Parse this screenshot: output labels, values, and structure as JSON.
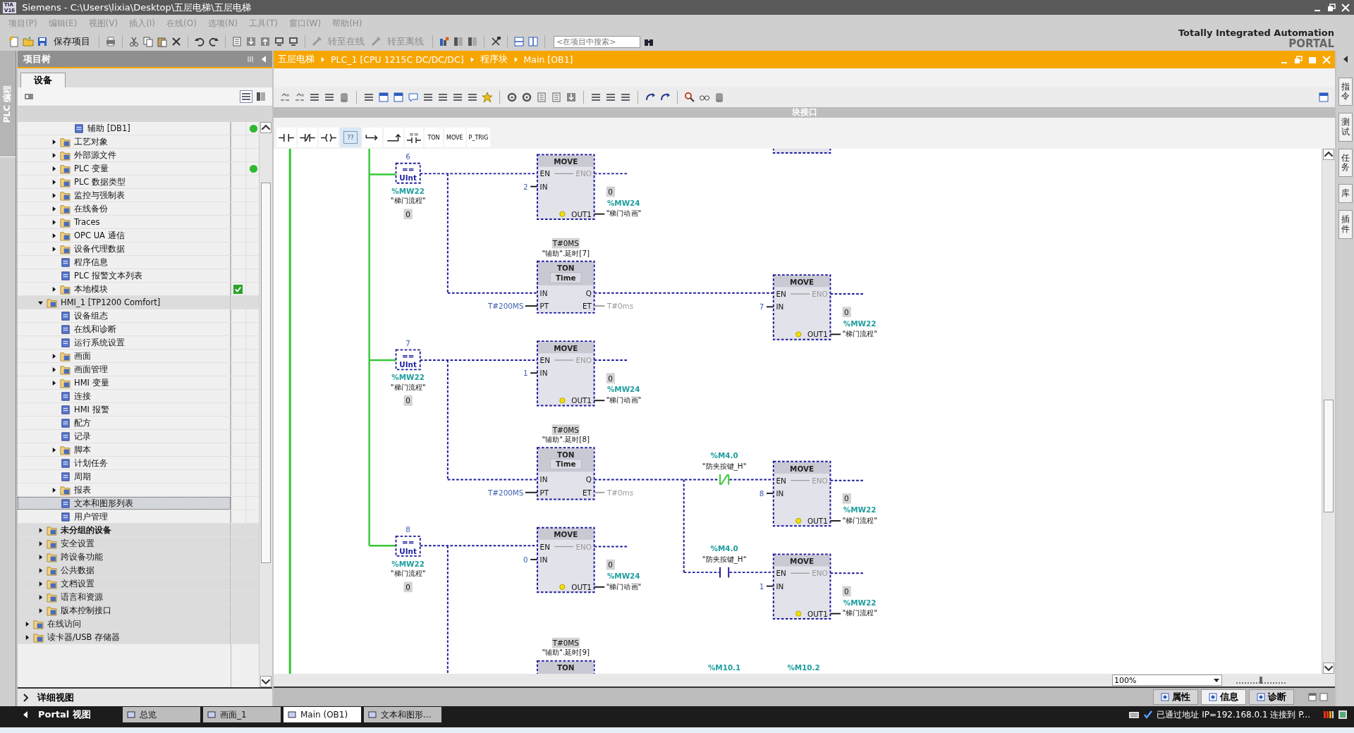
{
  "window": {
    "logo": [
      "TIA",
      "V16"
    ],
    "title": "Siemens  -  C:\\Users\\lixia\\Desktop\\五层电梯\\五层电梯"
  },
  "menu": [
    "项目(P)",
    "编辑(E)",
    "视图(V)",
    "插入(I)",
    "在线(O)",
    "选项(N)",
    "工具(T)",
    "窗口(W)",
    "帮助(H)"
  ],
  "toolbar": {
    "save": "保存项目",
    "go_online": "转至在线",
    "go_offline": "转至离线",
    "search": {
      "placeholder": "<在项目中搜索>"
    }
  },
  "branding": {
    "line1": "Totally Integrated Automation",
    "line2": "PORTAL"
  },
  "side_tab": "PLC 编程",
  "project_tree": {
    "title": "项目树",
    "tabs": [
      {
        "label": "设备",
        "selected": true
      }
    ],
    "items": [
      {
        "children": [
          {
            "children": [
              {
                "children": [
                  {
                    "label": "辅助 [DB1]",
                    "online": true,
                    "selected": false
                  }
                ]
              },
              {
                "label": "工艺对象",
                "expanded": false,
                "selected": false
              },
              {
                "label": "外部源文件",
                "expanded": false,
                "selected": false
              },
              {
                "label": "PLC 变量",
                "expanded": false,
                "online": true,
                "selected": false
              },
              {
                "label": "PLC 数据类型",
                "expanded": false,
                "selected": false
              },
              {
                "label": "监控与强制表",
                "expanded": false,
                "selected": false
              },
              {
                "label": "在线备份",
                "expanded": false,
                "selected": false
              },
              {
                "label": "Traces",
                "expanded": false,
                "selected": false
              },
              {
                "label": "OPC UA 通信",
                "expanded": false,
                "selected": false
              },
              {
                "label": "设备代理数据",
                "expanded": false,
                "selected": false
              },
              {
                "label": "程序信息",
                "selected": false
              },
              {
                "label": "PLC 报警文本列表",
                "selected": false
              },
              {
                "label": "本地模块",
                "expanded": false,
                "consistent": true,
                "selected": false
              }
            ]
          },
          {
            "label": "HMI_1 [TP1200 Comfort]",
            "expanded": true,
            "selected": false,
            "children": [
              {
                "label": "设备组态",
                "selected": false
              },
              {
                "label": "在线和诊断",
                "selected": false
              },
              {
                "label": "运行系统设置",
                "selected": false
              },
              {
                "label": "画面",
                "expanded": false,
                "selected": false
              },
              {
                "label": "画面管理",
                "expanded": false,
                "selected": false
              },
              {
                "label": "HMI 变量",
                "expanded": false,
                "selected": false
              },
              {
                "label": "连接",
                "selected": false
              },
              {
                "label": "HMI 报警",
                "selected": false
              },
              {
                "label": "配方",
                "selected": false
              },
              {
                "label": "记录",
                "selected": false
              },
              {
                "label": "脚本",
                "expanded": false,
                "selected": false
              },
              {
                "label": "计划任务",
                "selected": false
              },
              {
                "label": "周期",
                "selected": false
              },
              {
                "label": "报表",
                "expanded": false,
                "selected": false
              },
              {
                "label": "文本和图形列表",
                "selected": true
              },
              {
                "label": "用户管理",
                "selected": false
              }
            ]
          },
          {
            "label": "未分组的设备",
            "expanded": false,
            "emphasized": true,
            "selected": false
          },
          {
            "label": "安全设置",
            "expanded": false,
            "selected": false
          },
          {
            "label": "跨设备功能",
            "expanded": false,
            "selected": false
          },
          {
            "label": "公共数据",
            "expanded": false,
            "selected": false
          },
          {
            "label": "文档设置",
            "expanded": false,
            "selected": false
          },
          {
            "label": "语言和资源",
            "expanded": false,
            "selected": false
          },
          {
            "label": "版本控制接口",
            "expanded": false,
            "selected": false
          }
        ]
      },
      {
        "label": "在线访问",
        "expanded": false,
        "selected": false
      },
      {
        "label": "读卡器/USB 存储器",
        "expanded": false,
        "selected": false
      }
    ],
    "detail_view": "详细视图"
  },
  "editor": {
    "breadcrumb": [
      "五层电梯",
      "PLC_1 [CPU 1215C DC/DC/DC]",
      "程序块",
      "Main [OB1]"
    ],
    "block_interface": "块接口",
    "favorites": [
      {
        "kind": "no-contact"
      },
      {
        "kind": "nc-contact"
      },
      {
        "kind": "coil"
      },
      {
        "kind": "empty-box",
        "label": "??"
      },
      {
        "kind": "branch-open"
      },
      {
        "kind": "branch-close"
      },
      {
        "kind": "compare",
        "label": "=="
      },
      {
        "kind": "text",
        "label": "TON"
      },
      {
        "kind": "text",
        "label": "MOVE"
      },
      {
        "kind": "text",
        "label": "P_TRIG"
      }
    ],
    "ladder": [
      {
        "kind": "compare",
        "value": "6",
        "operator": "==",
        "data_type": "UInt",
        "address": "%MW22",
        "symbol": "\"梯门流程\"",
        "monitor": "0"
      },
      {
        "kind": "move",
        "title": "MOVE",
        "pins": [
          "EN",
          "ENO",
          "IN",
          "OUT1"
        ],
        "input": "2",
        "monitor": "0",
        "address": "%MW24",
        "symbol": "\"梯门动画\""
      },
      {
        "kind": "ton",
        "preset_monitor": "T#0MS",
        "instance": "\"辅助\".延时[7]",
        "title": "TON",
        "time_type": "Time",
        "pins": [
          "IN",
          "Q",
          "PT",
          "ET"
        ],
        "preset": "T#200MS",
        "elapsed": "T#0ms"
      },
      {
        "kind": "move",
        "title": "MOVE",
        "pins": [
          "EN",
          "ENO",
          "IN",
          "OUT1"
        ],
        "input": "7",
        "monitor": "0",
        "address": "%MW22",
        "symbol": "\"梯门流程\""
      },
      {
        "kind": "compare",
        "value": "7",
        "operator": "==",
        "data_type": "UInt",
        "address": "%MW22",
        "symbol": "\"梯门流程\"",
        "monitor": "0"
      },
      {
        "kind": "move",
        "title": "MOVE",
        "pins": [
          "EN",
          "ENO",
          "IN",
          "OUT1"
        ],
        "input": "1",
        "monitor": "0",
        "address": "%MW24",
        "symbol": "\"梯门动画\""
      },
      {
        "kind": "ton",
        "preset_monitor": "T#0MS",
        "instance": "\"辅助\".延时[8]",
        "title": "TON",
        "time_type": "Time",
        "pins": [
          "IN",
          "Q",
          "PT",
          "ET"
        ],
        "preset": "T#200MS",
        "elapsed": "T#0ms"
      },
      {
        "kind": "contact",
        "negated": true,
        "powered": true,
        "address": "%M4.0",
        "symbol": "\"防夹按键_H\""
      },
      {
        "kind": "move",
        "title": "MOVE",
        "pins": [
          "EN",
          "ENO",
          "IN",
          "OUT1"
        ],
        "input": "8",
        "monitor": "0",
        "address": "%MW22",
        "symbol": "\"梯门流程\""
      },
      {
        "kind": "contact",
        "negated": false,
        "powered": false,
        "address": "%M4.0",
        "symbol": "\"防夹按键_H\""
      },
      {
        "kind": "move",
        "title": "MOVE",
        "pins": [
          "EN",
          "ENO",
          "IN",
          "OUT1"
        ],
        "input": "1",
        "monitor": "0",
        "address": "%MW22",
        "symbol": "\"梯门流程\""
      },
      {
        "kind": "compare",
        "value": "8",
        "operator": "==",
        "data_type": "UInt",
        "address": "%MW22",
        "symbol": "\"梯门流程\"",
        "monitor": "0"
      },
      {
        "kind": "move",
        "title": "MOVE",
        "pins": [
          "EN",
          "ENO",
          "IN",
          "OUT1"
        ],
        "input": "0",
        "monitor": "0",
        "address": "%MW24",
        "symbol": "\"梯门动画\""
      },
      {
        "kind": "ton",
        "preset_monitor": "T#0MS",
        "instance": "\"辅助\".延时[9]",
        "title": "TON"
      },
      {
        "kind": "address",
        "address": "%M10.1"
      },
      {
        "kind": "address",
        "address": "%M10.2"
      }
    ],
    "zoom": "100%",
    "zoom_slider": {
      "level": 0.5
    }
  },
  "task_cards": [
    {
      "label": "指令"
    },
    {
      "label": "测试"
    },
    {
      "label": "任务"
    },
    {
      "label": "库"
    },
    {
      "label": "插件"
    }
  ],
  "inspector_tabs": [
    {
      "label": "属性",
      "selected": false
    },
    {
      "label": "信息",
      "selected": true
    },
    {
      "label": "诊断",
      "selected": false
    }
  ],
  "portal_bar": {
    "portal_view": "Portal 视图",
    "tabs": [
      {
        "label": "总览",
        "selected": false
      },
      {
        "label": "画面_1",
        "selected": false
      },
      {
        "label": "Main (OB1)",
        "selected": true
      },
      {
        "label": "文本和图形...",
        "selected": false
      }
    ],
    "status": "已通过地址 IP=192.168.0.1 连接到 P..."
  }
}
